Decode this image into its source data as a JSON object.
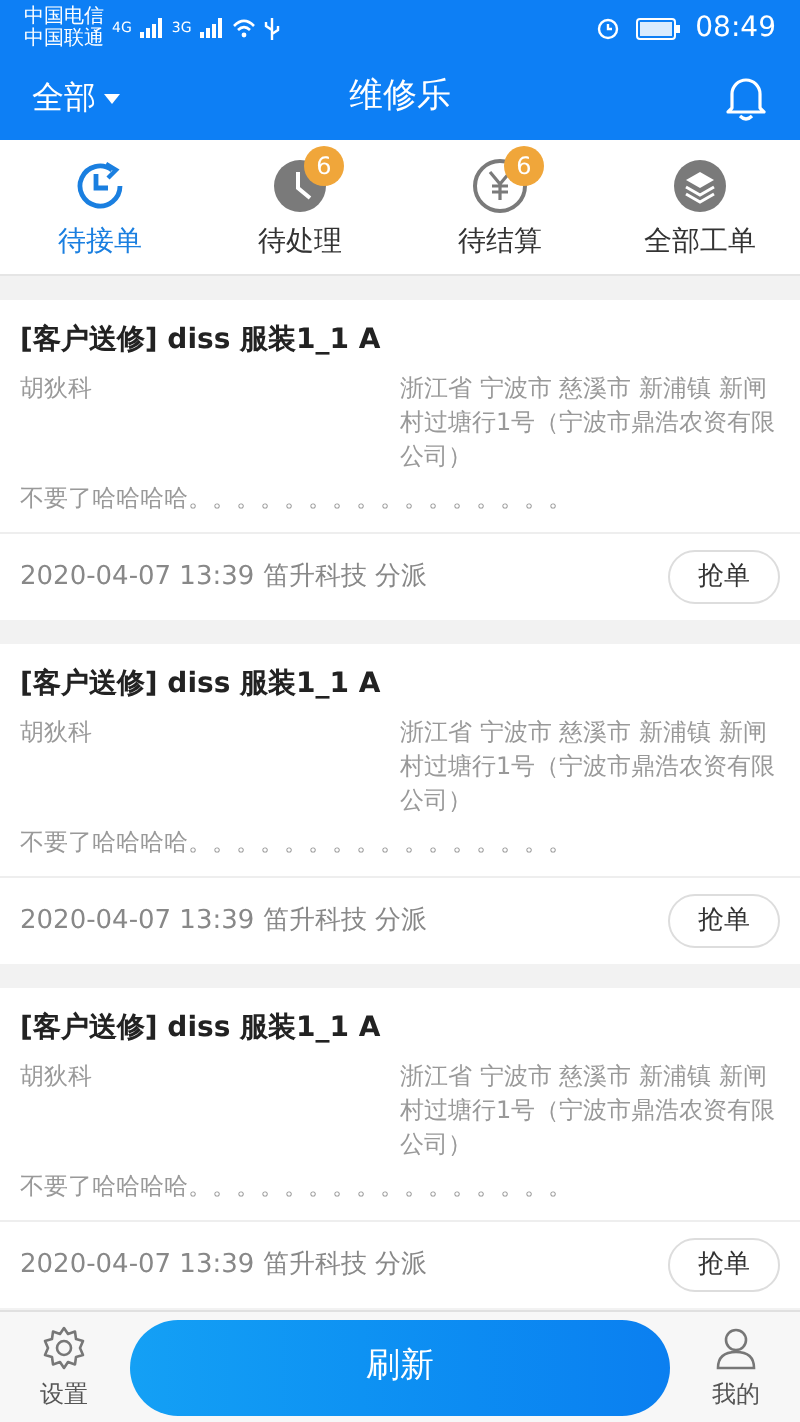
{
  "status_bar": {
    "carriers": [
      "中国电信",
      "中国联通"
    ],
    "network_1": "4G",
    "network_2": "3G",
    "time": "08:49"
  },
  "header": {
    "filter": "全部",
    "title": "维修乐"
  },
  "tabs": [
    {
      "label": "待接单",
      "selected": true,
      "kind": "pending"
    },
    {
      "label": "待处理",
      "selected": false,
      "kind": "processing",
      "badge": "6"
    },
    {
      "label": "待结算",
      "selected": false,
      "kind": "settle",
      "badge": "6"
    },
    {
      "label": "全部工单",
      "selected": false,
      "kind": "all"
    }
  ],
  "orders": [
    {
      "title": "[客户送修] diss 服装1_1 A",
      "customer": "胡狄科",
      "address": "浙江省 宁波市 慈溪市 新浦镇 新闸村过塘行1号（宁波市鼎浩农资有限公司）",
      "remark": "不要了哈哈哈哈。。。。。。。。。。。。。。。。",
      "footer": "2020-04-07 13:39 笛升科技 分派",
      "action": "抢单"
    },
    {
      "title": "[客户送修] diss 服装1_1 A",
      "customer": "胡狄科",
      "address": "浙江省 宁波市 慈溪市 新浦镇 新闸村过塘行1号（宁波市鼎浩农资有限公司）",
      "remark": "不要了哈哈哈哈。。。。。。。。。。。。。。。。",
      "footer": "2020-04-07 13:39 笛升科技 分派",
      "action": "抢单"
    },
    {
      "title": "[客户送修] diss 服装1_1 A",
      "customer": "胡狄科",
      "address": "浙江省 宁波市 慈溪市 新浦镇 新闸村过塘行1号（宁波市鼎浩农资有限公司）",
      "remark": "不要了哈哈哈哈。。。。。。。。。。。。。。。。",
      "footer": "2020-04-07 13:39 笛升科技 分派",
      "action": "抢单"
    }
  ],
  "bottom_nav": {
    "left": "设置",
    "center": "刷新",
    "right": "我的"
  }
}
